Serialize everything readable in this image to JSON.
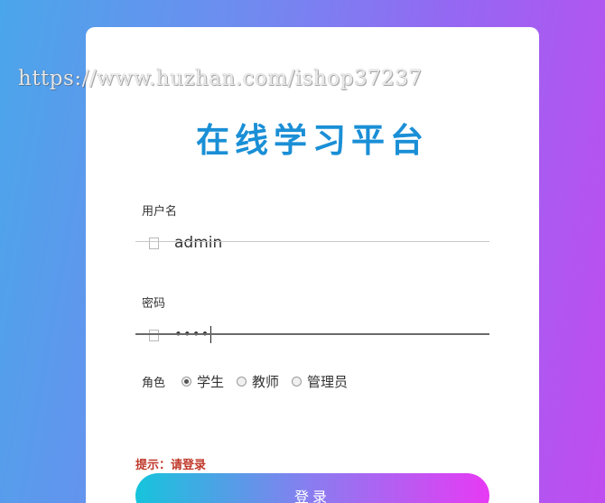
{
  "watermark": "https://www.huzhan.com/ishop37237",
  "title": "在线学习平台",
  "username": {
    "label": "用户名",
    "value": "admin",
    "icon": "user-icon"
  },
  "password": {
    "label": "密码",
    "value": "••••",
    "icon": "lock-icon"
  },
  "role": {
    "label": "角色",
    "options": [
      "学生",
      "教师",
      "管理员"
    ],
    "selected": "学生"
  },
  "hint": "提示：请登录",
  "login_button": "登录",
  "colors": {
    "title": "#1a8fd6",
    "hint": "#c0392b",
    "button_start": "#16c4dc",
    "button_end": "#e73af4"
  }
}
